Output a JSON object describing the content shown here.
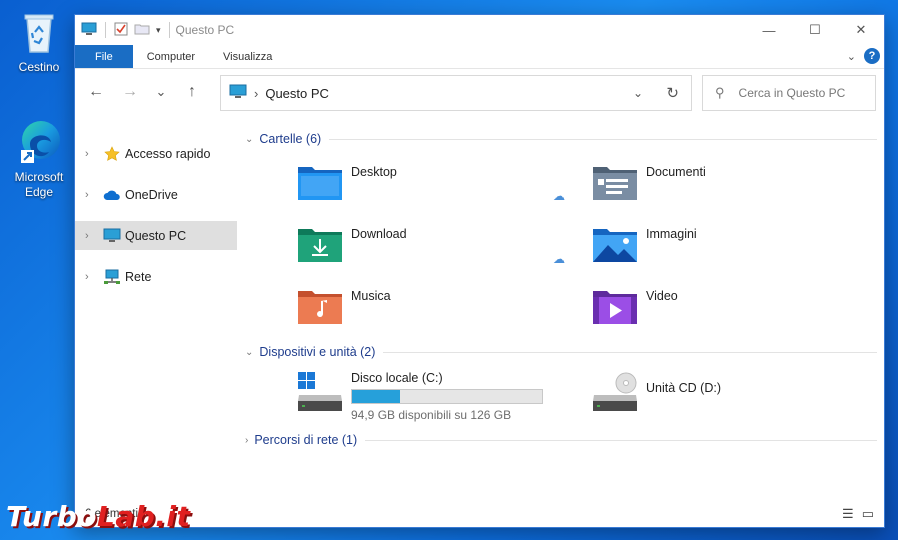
{
  "desktop": {
    "icons": [
      {
        "label": "Cestino",
        "icon": "recycle-bin-icon"
      },
      {
        "label": "Microsoft Edge",
        "label_line1": "Microsoft",
        "label_line2": "Edge",
        "icon": "edge-icon"
      }
    ]
  },
  "window": {
    "title": "Questo PC",
    "controls": {
      "minimize": "—",
      "maximize": "☐",
      "close": "✕"
    }
  },
  "ribbon": {
    "tabs": [
      "File",
      "Computer",
      "Visualizza"
    ]
  },
  "nav": {
    "back": "←",
    "forward": "→",
    "recent": "⌄",
    "up": "↑",
    "address": "Questo PC",
    "search_placeholder": "Cerca in Questo PC"
  },
  "sidebar": {
    "items": [
      {
        "label": "Accesso rapido",
        "icon": "star-icon"
      },
      {
        "label": "OneDrive",
        "icon": "cloud-icon"
      },
      {
        "label": "Questo PC",
        "icon": "computer-icon",
        "selected": true
      },
      {
        "label": "Rete",
        "icon": "network-icon"
      }
    ]
  },
  "groups": {
    "folders_header": "Cartelle (6)",
    "devices_header": "Dispositivi e unità (2)",
    "network_header": "Percorsi di rete (1)"
  },
  "folders": [
    {
      "name": "Desktop",
      "icon": "desktop-folder-icon",
      "color": "#1e88e5"
    },
    {
      "name": "Documenti",
      "icon": "documents-folder-icon",
      "color": "#6b7d92"
    },
    {
      "name": "Download",
      "icon": "download-folder-icon",
      "color": "#1fa37a"
    },
    {
      "name": "Immagini",
      "icon": "pictures-folder-icon",
      "color": "#1e88e5"
    },
    {
      "name": "Musica",
      "icon": "music-folder-icon",
      "color": "#e8704a"
    },
    {
      "name": "Video",
      "icon": "video-folder-icon",
      "color": "#8a3fd1"
    }
  ],
  "drives": [
    {
      "name": "Disco locale (C:)",
      "free": "94,9 GB disponibili su 126 GB",
      "used_fraction": 0.25
    },
    {
      "name": "Unità CD (D:)"
    }
  ],
  "status": {
    "text": "6 elementi"
  },
  "watermark": {
    "part1": "Turbo",
    "part2": "Lab.it"
  }
}
